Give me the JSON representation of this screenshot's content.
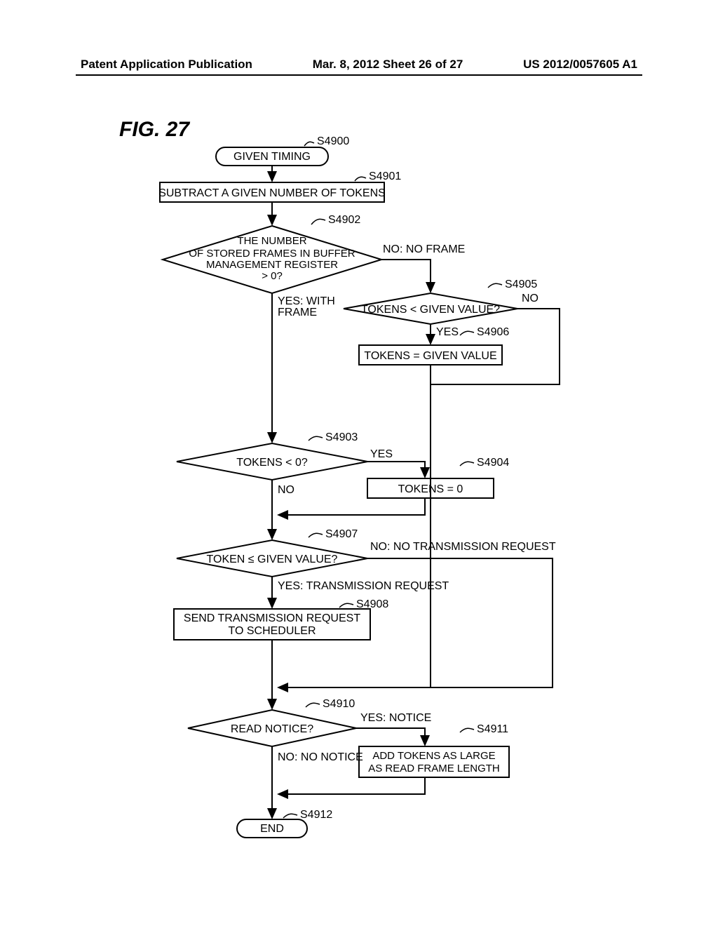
{
  "header": {
    "left": "Patent Application Publication",
    "mid": "Mar. 8, 2012  Sheet 26 of 27",
    "right": "US 2012/0057605 A1"
  },
  "figure_title": "FIG.  27",
  "steps": {
    "s4900_label": "S4900",
    "s4900_text": "GIVEN TIMING",
    "s4901_label": "S4901",
    "s4901_text": "SUBTRACT A GIVEN NUMBER OF TOKENS",
    "s4902_label": "S4902",
    "s4902_text1": "THE NUMBER",
    "s4902_text2": "OF STORED FRAMES IN BUFFER",
    "s4902_text3": "MANAGEMENT REGISTER",
    "s4902_text4": "> 0?",
    "s4902_no": "NO: NO FRAME",
    "s4902_yes1": "YES: WITH",
    "s4902_yes2": "FRAME",
    "s4905_label": "S4905",
    "s4905_text": "TOKENS < GIVEN VALUE?",
    "s4905_no": "NO",
    "s4905_yes": "YES",
    "s4906_label": "S4906",
    "s4906_text": "TOKENS = GIVEN VALUE",
    "s4903_label": "S4903",
    "s4903_text": "TOKENS < 0?",
    "s4903_no": "NO",
    "s4903_yes": "YES",
    "s4904_label": "S4904",
    "s4904_text": "TOKENS = 0",
    "s4907_label": "S4907",
    "s4907_text": "TOKEN ≤ GIVEN VALUE?",
    "s4907_no": "NO: NO TRANSMISSION REQUEST",
    "s4907_yes": "YES: TRANSMISSION REQUEST",
    "s4908_label": "S4908",
    "s4908_text1": "SEND TRANSMISSION REQUEST",
    "s4908_text2": "TO SCHEDULER",
    "s4910_label": "S4910",
    "s4910_text": "READ NOTICE?",
    "s4910_yes": "YES: NOTICE",
    "s4910_no": "NO: NO NOTICE",
    "s4911_label": "S4911",
    "s4911_text1": "ADD TOKENS AS LARGE",
    "s4911_text2": "AS READ FRAME LENGTH",
    "s4912_label": "S4912",
    "s4912_text": "END"
  }
}
